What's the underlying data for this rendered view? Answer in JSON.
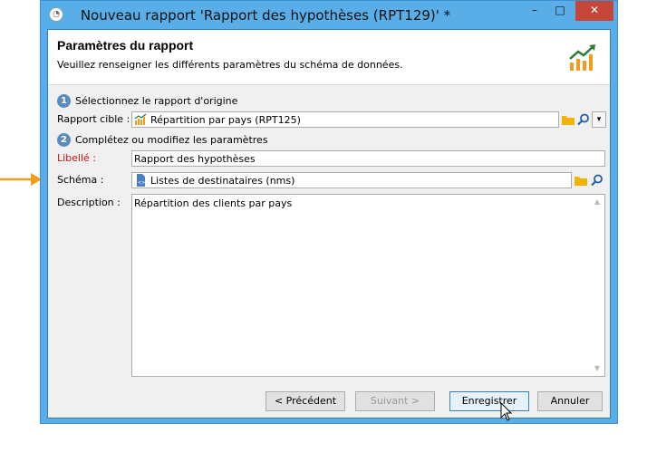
{
  "window": {
    "title": "Nouveau rapport 'Rapport des hypothèses (RPT129)' *",
    "controls": {
      "minimize": "–",
      "maximize": "□",
      "close": "✕"
    }
  },
  "header": {
    "title": "Paramètres du rapport",
    "subtitle": "Veuillez renseigner les différents paramètres du schéma de données.",
    "icon": "chart-trend-icon"
  },
  "step1": {
    "number": "1",
    "label": "Sélectionnez le rapport d'origine"
  },
  "rapport_cible": {
    "label": "Rapport cible :",
    "value": "Répartition par pays (RPT125)",
    "icon": "report-chart-icon"
  },
  "step2": {
    "number": "2",
    "label": "Complétez ou modifiez les paramètres"
  },
  "libelle": {
    "label": "Libellé :",
    "value": "Rapport des hypothèses"
  },
  "schema": {
    "label": "Schéma :",
    "value": "Listes de destinataires (nms)",
    "icon": "schema-file-icon"
  },
  "description": {
    "label": "Description :",
    "value": "Répartition des clients par pays"
  },
  "buttons": {
    "previous": "< Précédent",
    "next": "Suivant >",
    "save": "Enregistrer",
    "cancel": "Annuler"
  },
  "colors": {
    "titlebar": "#5aaee8",
    "close": "#c7463a",
    "required_label": "#cc1111",
    "annotation_arrow": "#f29c1f",
    "chart_icon": "#f29c1f"
  }
}
